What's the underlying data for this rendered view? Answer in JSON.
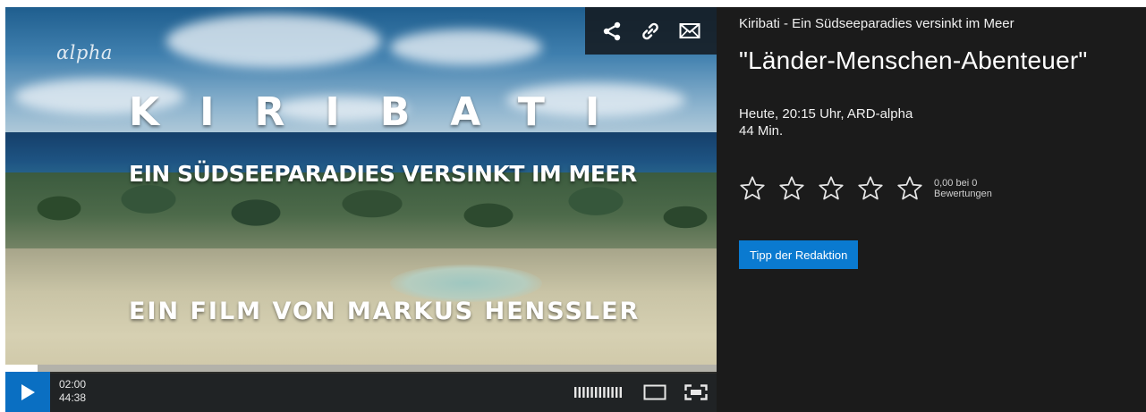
{
  "player": {
    "logo": "αlpha",
    "overlay_title": "KIRIBATI",
    "overlay_subtitle": "EIN SÜDSEEPARADIES VERSINKT IM MEER",
    "overlay_credit": "EIN FILM VON MARKUS HENSSLER",
    "current_time": "02:00",
    "total_time": "44:38",
    "progress_fraction": 0.045,
    "share_icons": [
      "share-icon",
      "link-icon",
      "mail-icon"
    ],
    "control_icons": [
      "play-icon",
      "quality-icon",
      "window-icon",
      "fullscreen-icon"
    ]
  },
  "info": {
    "show_title": "Kiribati - Ein Südseeparadies versinkt im Meer",
    "series": "\"Länder-Menschen-Abenteuer\"",
    "airtime": "Heute, 20:15 Uhr, ARD-alpha",
    "duration": "44 Min.",
    "rating_value": "0,00 bei 0",
    "rating_count_label": "Bewertungen",
    "stars_total": 5,
    "stars_filled": 0,
    "badge": "Tipp der Redaktion"
  },
  "colors": {
    "accent": "#0a7ad0",
    "panel_bg": "#1b1b1b",
    "text": "#ffffff"
  }
}
